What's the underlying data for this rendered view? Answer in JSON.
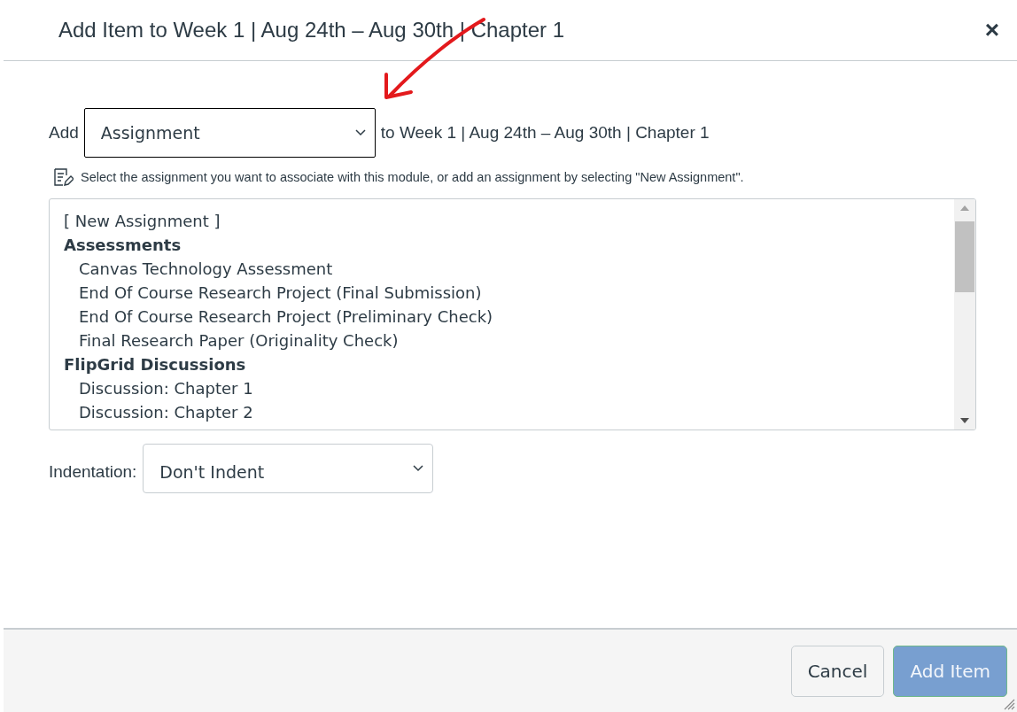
{
  "dialog": {
    "title": "Add Item to Week 1 | Aug 24th – Aug 30th | Chapter 1",
    "close": "×"
  },
  "add_row": {
    "label": "Add",
    "type_select": "Assignment",
    "suffix": "to Week 1 | Aug 24th – Aug 30th | Chapter 1"
  },
  "hint": "Select the assignment you want to associate with this module, or add an assignment by selecting \"New Assignment\".",
  "items": [
    {
      "label": "[ New Assignment ]"
    },
    {
      "label": "Assessments",
      "children": [
        {
          "label": "Canvas Technology Assessment"
        },
        {
          "label": "End Of Course Research Project (Final Submission)"
        },
        {
          "label": "End Of Course Research Project (Preliminary Check)"
        },
        {
          "label": "Final Research Paper (Originality Check)"
        }
      ]
    },
    {
      "label": "FlipGrid Discussions",
      "children": [
        {
          "label": "Discussion: Chapter 1"
        },
        {
          "label": "Discussion: Chapter 2"
        }
      ]
    }
  ],
  "indentation": {
    "label": "Indentation:",
    "value": "Don't Indent"
  },
  "buttons": [
    {
      "label": "Cancel",
      "kind": "secondary",
      "disabled": false
    },
    {
      "label": "Add Item",
      "kind": "primary",
      "disabled": true
    }
  ]
}
